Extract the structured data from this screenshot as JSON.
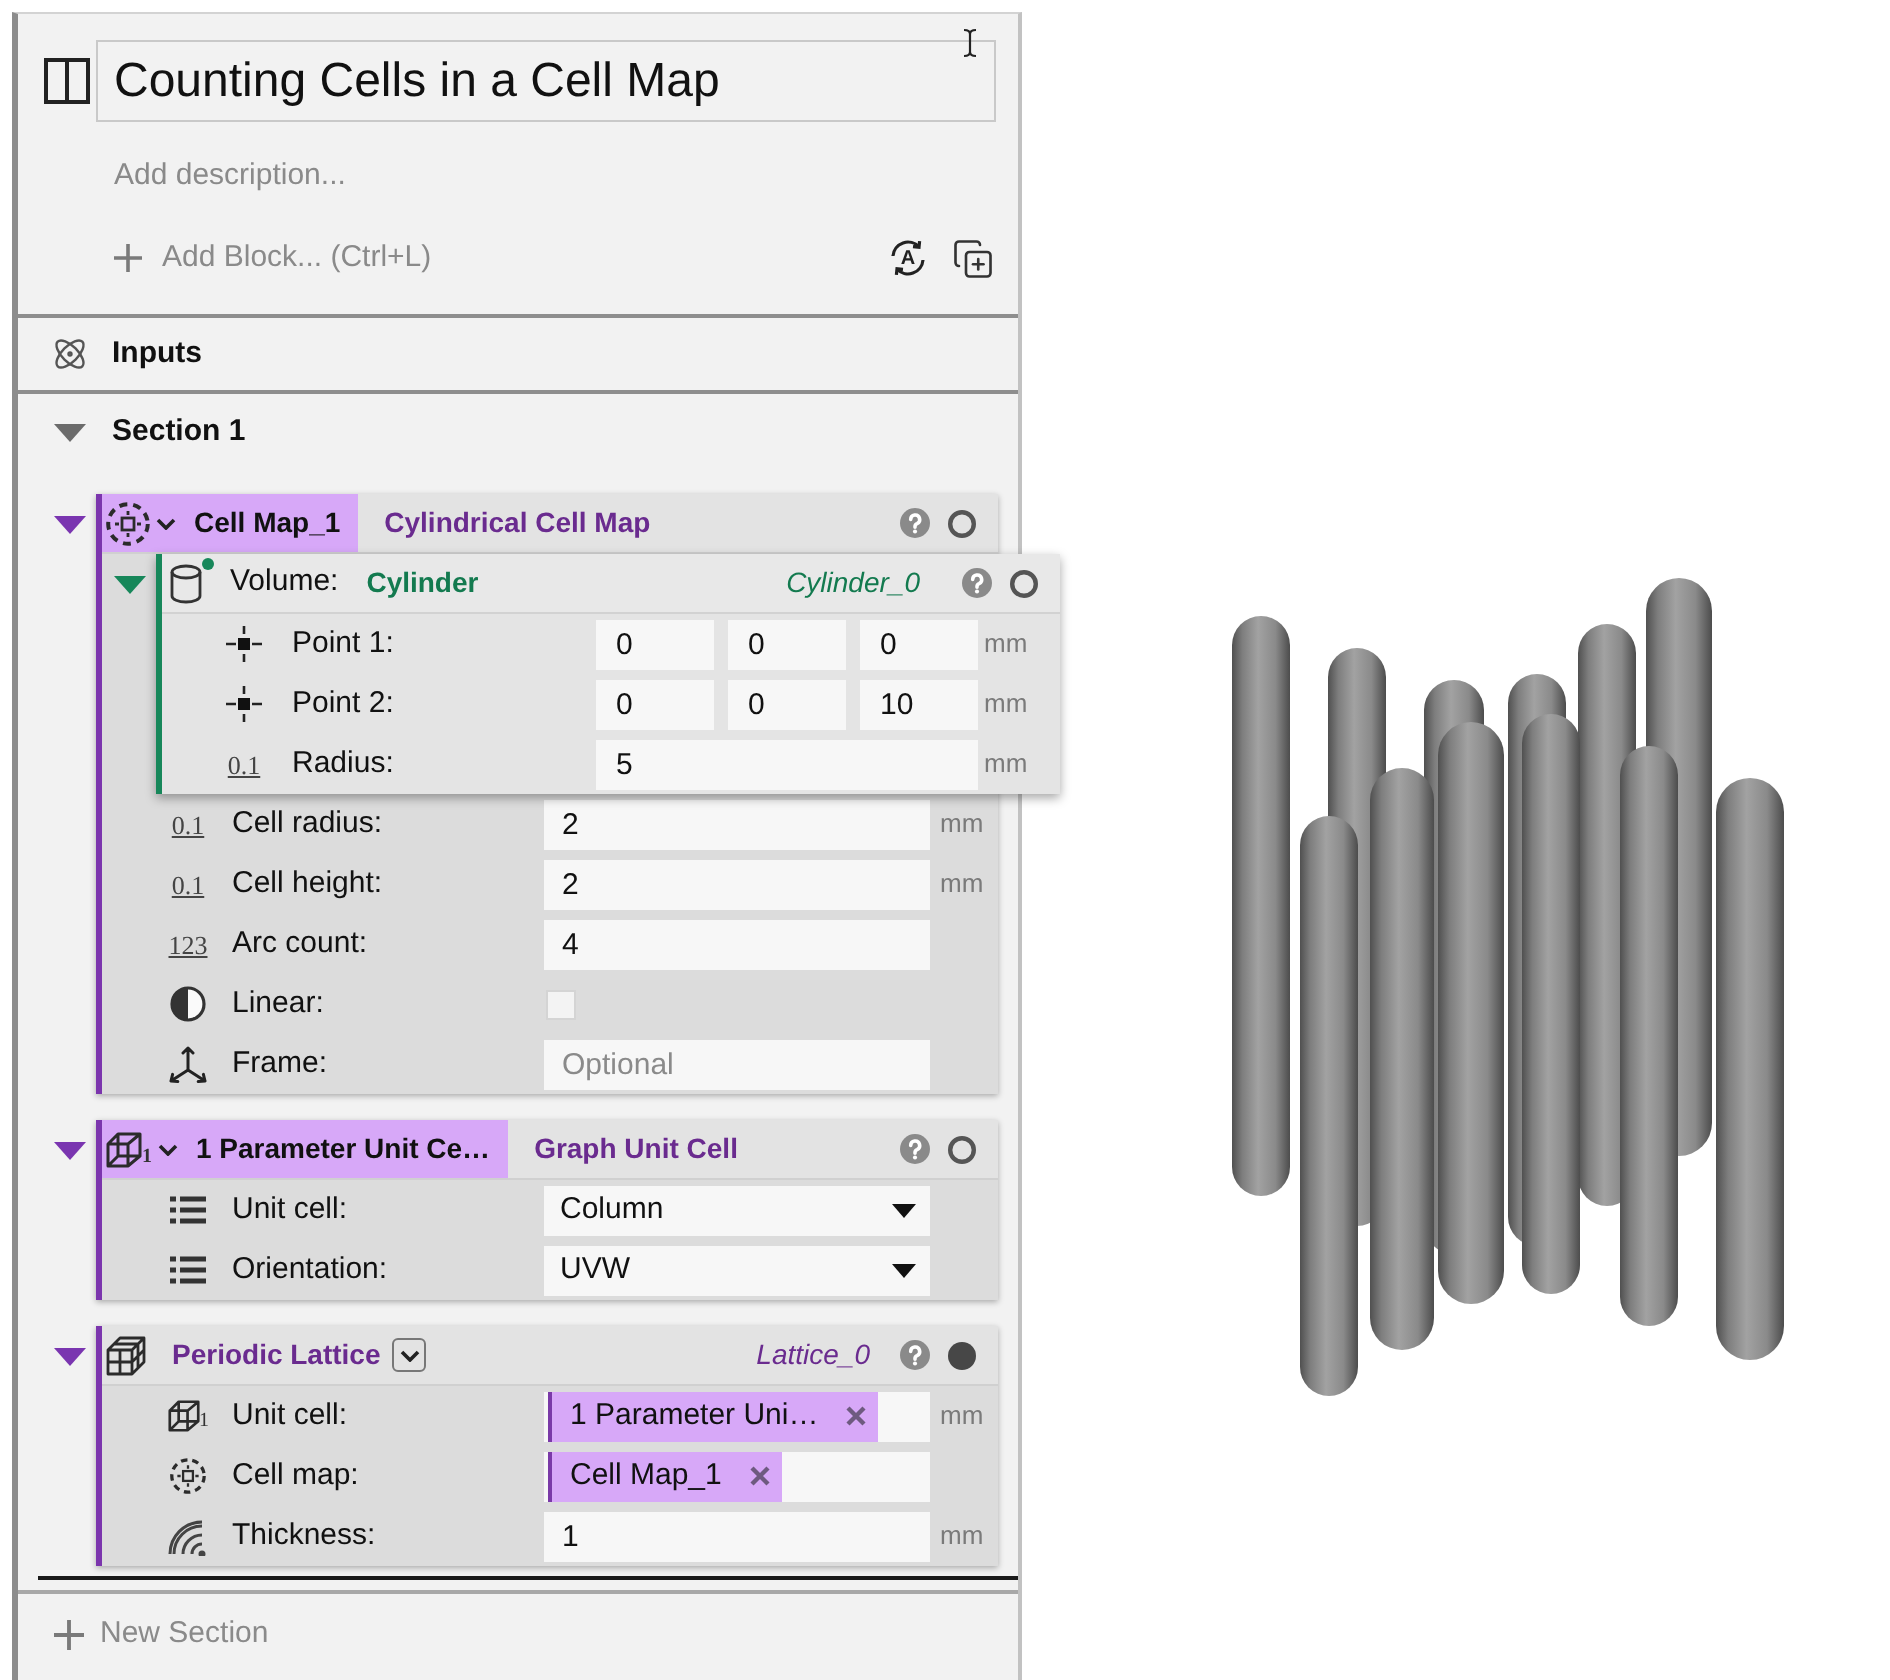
{
  "document": {
    "title": "Counting Cells in a Cell Map",
    "description_placeholder": "Add description...",
    "add_block": "Add Block... (Ctrl+L)",
    "auto_button": "A"
  },
  "inputs": {
    "label": "Inputs"
  },
  "sections": [
    {
      "title": "Section 1",
      "expanded": true,
      "blocks": [
        {
          "kind": "cell_map",
          "name": "Cell Map_1",
          "type": "Cylindrical Cell Map",
          "expanded": true,
          "visible": false,
          "inputs": [
            {
              "kind": "volume",
              "label": "Volume:",
              "type": "Cylinder",
              "variable": "Cylinder_0",
              "expanded": true,
              "visible": false,
              "inputs": [
                {
                  "kind": "point",
                  "label": "Point 1:",
                  "values": [
                    "0",
                    "0",
                    "0"
                  ],
                  "unit": "mm"
                },
                {
                  "kind": "point",
                  "label": "Point 2:",
                  "values": [
                    "0",
                    "0",
                    "10"
                  ],
                  "unit": "mm"
                },
                {
                  "kind": "real",
                  "icon_text": "0.1",
                  "label": "Radius:",
                  "value": "5",
                  "unit": "mm"
                }
              ]
            },
            {
              "kind": "real",
              "icon_text": "0.1",
              "label": "Cell radius:",
              "value": "2",
              "unit": "mm"
            },
            {
              "kind": "real",
              "icon_text": "0.1",
              "label": "Cell height:",
              "value": "2",
              "unit": "mm"
            },
            {
              "kind": "integer",
              "icon_text": "123",
              "label": "Arc count:",
              "value": "4"
            },
            {
              "kind": "toggle",
              "label": "Linear:",
              "checked": false
            },
            {
              "kind": "frame",
              "label": "Frame:",
              "placeholder": "Optional"
            }
          ]
        },
        {
          "kind": "unit_cell",
          "name": "1 Parameter Unit Ce…",
          "icon_text": "1",
          "type": "Graph Unit Cell",
          "expanded": true,
          "visible": false,
          "inputs": [
            {
              "kind": "enum",
              "label": "Unit cell:",
              "value": "Column"
            },
            {
              "kind": "enum",
              "label": "Orientation:",
              "value": "UVW"
            }
          ]
        },
        {
          "kind": "lattice",
          "type": "Periodic Lattice",
          "variable": "Lattice_0",
          "expanded": true,
          "visible": true,
          "inputs": [
            {
              "kind": "unit_cell_ref",
              "icon_text": "1",
              "label": "Unit cell:",
              "reference": "1 Parameter Uni…",
              "unit": "mm"
            },
            {
              "kind": "cell_map_ref",
              "label": "Cell map:",
              "reference": "Cell Map_1"
            },
            {
              "kind": "thickness",
              "label": "Thickness:",
              "value": "1",
              "unit": "mm"
            }
          ]
        }
      ]
    }
  ],
  "new_section": "New Section"
}
